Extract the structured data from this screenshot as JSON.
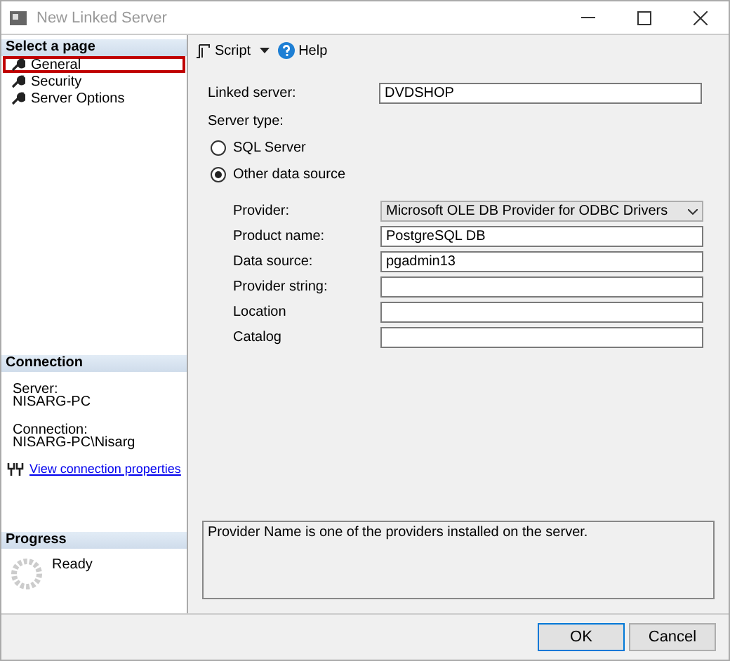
{
  "window": {
    "title": "New Linked Server"
  },
  "sidebar": {
    "header": "Select a page",
    "items": [
      {
        "label": "General",
        "selected": true
      },
      {
        "label": "Security",
        "selected": false
      },
      {
        "label": "Server Options",
        "selected": false
      }
    ]
  },
  "connection": {
    "header": "Connection",
    "server_label": "Server:",
    "server": "NISARG-PC",
    "connection_label": "Connection:",
    "connection": "NISARG-PC\\Nisarg",
    "link": "View connection properties"
  },
  "progress": {
    "header": "Progress",
    "status": "Ready"
  },
  "toolbar": {
    "script": "Script",
    "help": "Help"
  },
  "form": {
    "linked_server_label": "Linked server:",
    "linked_server": "DVDSHOP",
    "server_type_label": "Server type:",
    "server_types": [
      {
        "label": "SQL Server",
        "selected": false
      },
      {
        "label": "Other data source",
        "selected": true
      }
    ],
    "fields": [
      {
        "kind": "dropdown",
        "label": "Provider:",
        "value": "Microsoft OLE DB Provider for ODBC Drivers"
      },
      {
        "kind": "text",
        "label": "Product name:",
        "value": "PostgreSQL DB"
      },
      {
        "kind": "text",
        "label": "Data source:",
        "value": "pgadmin13"
      },
      {
        "kind": "text",
        "label": "Provider string:"
      },
      {
        "kind": "text",
        "label": "Location"
      },
      {
        "kind": "text",
        "label": "Catalog"
      }
    ],
    "description": "Provider Name is one of the providers installed on the server."
  },
  "buttons": [
    {
      "label": "OK",
      "kind": "default"
    },
    {
      "label": "Cancel",
      "kind": "normal"
    }
  ]
}
